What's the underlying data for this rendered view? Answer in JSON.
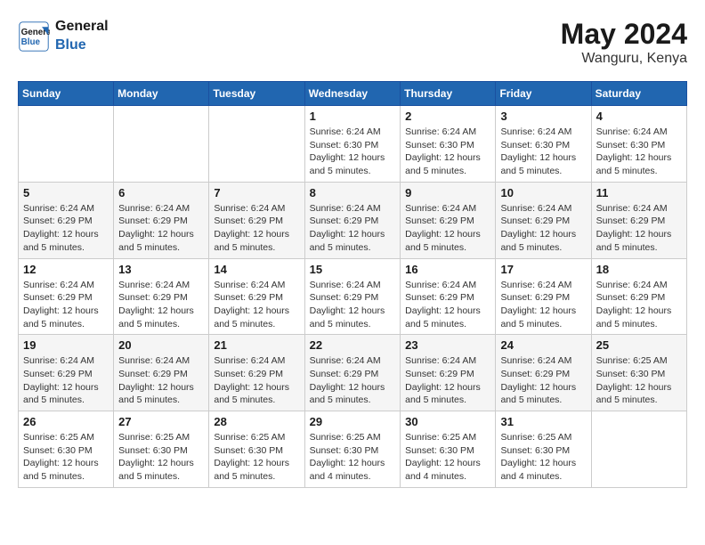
{
  "header": {
    "logo_line1": "General",
    "logo_line2": "Blue",
    "month_year": "May 2024",
    "location": "Wanguru, Kenya"
  },
  "weekdays": [
    "Sunday",
    "Monday",
    "Tuesday",
    "Wednesday",
    "Thursday",
    "Friday",
    "Saturday"
  ],
  "weeks": [
    [
      {
        "day": "",
        "info": ""
      },
      {
        "day": "",
        "info": ""
      },
      {
        "day": "",
        "info": ""
      },
      {
        "day": "1",
        "info": "Sunrise: 6:24 AM\nSunset: 6:30 PM\nDaylight: 12 hours\nand 5 minutes."
      },
      {
        "day": "2",
        "info": "Sunrise: 6:24 AM\nSunset: 6:30 PM\nDaylight: 12 hours\nand 5 minutes."
      },
      {
        "day": "3",
        "info": "Sunrise: 6:24 AM\nSunset: 6:30 PM\nDaylight: 12 hours\nand 5 minutes."
      },
      {
        "day": "4",
        "info": "Sunrise: 6:24 AM\nSunset: 6:30 PM\nDaylight: 12 hours\nand 5 minutes."
      }
    ],
    [
      {
        "day": "5",
        "info": "Sunrise: 6:24 AM\nSunset: 6:29 PM\nDaylight: 12 hours\nand 5 minutes."
      },
      {
        "day": "6",
        "info": "Sunrise: 6:24 AM\nSunset: 6:29 PM\nDaylight: 12 hours\nand 5 minutes."
      },
      {
        "day": "7",
        "info": "Sunrise: 6:24 AM\nSunset: 6:29 PM\nDaylight: 12 hours\nand 5 minutes."
      },
      {
        "day": "8",
        "info": "Sunrise: 6:24 AM\nSunset: 6:29 PM\nDaylight: 12 hours\nand 5 minutes."
      },
      {
        "day": "9",
        "info": "Sunrise: 6:24 AM\nSunset: 6:29 PM\nDaylight: 12 hours\nand 5 minutes."
      },
      {
        "day": "10",
        "info": "Sunrise: 6:24 AM\nSunset: 6:29 PM\nDaylight: 12 hours\nand 5 minutes."
      },
      {
        "day": "11",
        "info": "Sunrise: 6:24 AM\nSunset: 6:29 PM\nDaylight: 12 hours\nand 5 minutes."
      }
    ],
    [
      {
        "day": "12",
        "info": "Sunrise: 6:24 AM\nSunset: 6:29 PM\nDaylight: 12 hours\nand 5 minutes."
      },
      {
        "day": "13",
        "info": "Sunrise: 6:24 AM\nSunset: 6:29 PM\nDaylight: 12 hours\nand 5 minutes."
      },
      {
        "day": "14",
        "info": "Sunrise: 6:24 AM\nSunset: 6:29 PM\nDaylight: 12 hours\nand 5 minutes."
      },
      {
        "day": "15",
        "info": "Sunrise: 6:24 AM\nSunset: 6:29 PM\nDaylight: 12 hours\nand 5 minutes."
      },
      {
        "day": "16",
        "info": "Sunrise: 6:24 AM\nSunset: 6:29 PM\nDaylight: 12 hours\nand 5 minutes."
      },
      {
        "day": "17",
        "info": "Sunrise: 6:24 AM\nSunset: 6:29 PM\nDaylight: 12 hours\nand 5 minutes."
      },
      {
        "day": "18",
        "info": "Sunrise: 6:24 AM\nSunset: 6:29 PM\nDaylight: 12 hours\nand 5 minutes."
      }
    ],
    [
      {
        "day": "19",
        "info": "Sunrise: 6:24 AM\nSunset: 6:29 PM\nDaylight: 12 hours\nand 5 minutes."
      },
      {
        "day": "20",
        "info": "Sunrise: 6:24 AM\nSunset: 6:29 PM\nDaylight: 12 hours\nand 5 minutes."
      },
      {
        "day": "21",
        "info": "Sunrise: 6:24 AM\nSunset: 6:29 PM\nDaylight: 12 hours\nand 5 minutes."
      },
      {
        "day": "22",
        "info": "Sunrise: 6:24 AM\nSunset: 6:29 PM\nDaylight: 12 hours\nand 5 minutes."
      },
      {
        "day": "23",
        "info": "Sunrise: 6:24 AM\nSunset: 6:29 PM\nDaylight: 12 hours\nand 5 minutes."
      },
      {
        "day": "24",
        "info": "Sunrise: 6:24 AM\nSunset: 6:29 PM\nDaylight: 12 hours\nand 5 minutes."
      },
      {
        "day": "25",
        "info": "Sunrise: 6:25 AM\nSunset: 6:30 PM\nDaylight: 12 hours\nand 5 minutes."
      }
    ],
    [
      {
        "day": "26",
        "info": "Sunrise: 6:25 AM\nSunset: 6:30 PM\nDaylight: 12 hours\nand 5 minutes."
      },
      {
        "day": "27",
        "info": "Sunrise: 6:25 AM\nSunset: 6:30 PM\nDaylight: 12 hours\nand 5 minutes."
      },
      {
        "day": "28",
        "info": "Sunrise: 6:25 AM\nSunset: 6:30 PM\nDaylight: 12 hours\nand 5 minutes."
      },
      {
        "day": "29",
        "info": "Sunrise: 6:25 AM\nSunset: 6:30 PM\nDaylight: 12 hours\nand 4 minutes."
      },
      {
        "day": "30",
        "info": "Sunrise: 6:25 AM\nSunset: 6:30 PM\nDaylight: 12 hours\nand 4 minutes."
      },
      {
        "day": "31",
        "info": "Sunrise: 6:25 AM\nSunset: 6:30 PM\nDaylight: 12 hours\nand 4 minutes."
      },
      {
        "day": "",
        "info": ""
      }
    ]
  ]
}
